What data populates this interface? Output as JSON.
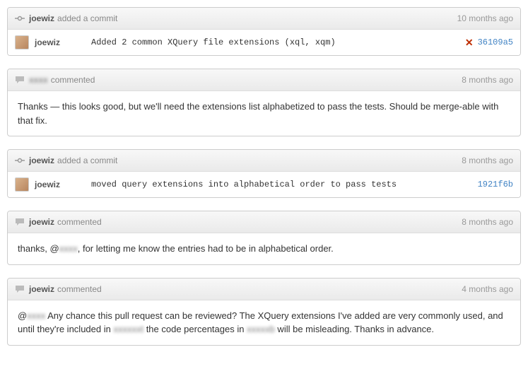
{
  "items": [
    {
      "type": "commit",
      "user": "joewiz",
      "action": "added a commit",
      "time": "10 months ago",
      "commit_author": "joewiz",
      "commit_msg": "Added 2 common XQuery file extensions (xql, xqm)",
      "status_icon": "✕",
      "sha": "36109a5"
    },
    {
      "type": "comment",
      "user_blurred": true,
      "user": "xxxx",
      "action": "commented",
      "time": "8 months ago",
      "body": "Thanks — this looks good, but we'll need the extensions list alphabetized to pass the tests. Should be merge-able with that fix."
    },
    {
      "type": "commit",
      "user": "joewiz",
      "action": "added a commit",
      "time": "8 months ago",
      "commit_author": "joewiz",
      "commit_msg": "moved query extensions into alphabetical order to pass tests",
      "status_icon": "",
      "sha": "1921f6b"
    },
    {
      "type": "comment",
      "user": "joewiz",
      "action": "commented",
      "time": "8 months ago",
      "body_parts": [
        "thanks, @",
        "xxxx",
        ", for letting me know the entries had to be in alphabetical order."
      ]
    },
    {
      "type": "comment",
      "user": "joewiz",
      "action": "commented",
      "time": "4 months ago",
      "body_parts": [
        "@",
        "xxxx",
        " Any chance this pull request can be reviewed? The XQuery extensions I've added are very commonly used, and until they're included in ",
        "xxxxxxt",
        " the code percentages in ",
        "xxxxxb",
        " will be misleading. Thanks in advance."
      ]
    }
  ]
}
